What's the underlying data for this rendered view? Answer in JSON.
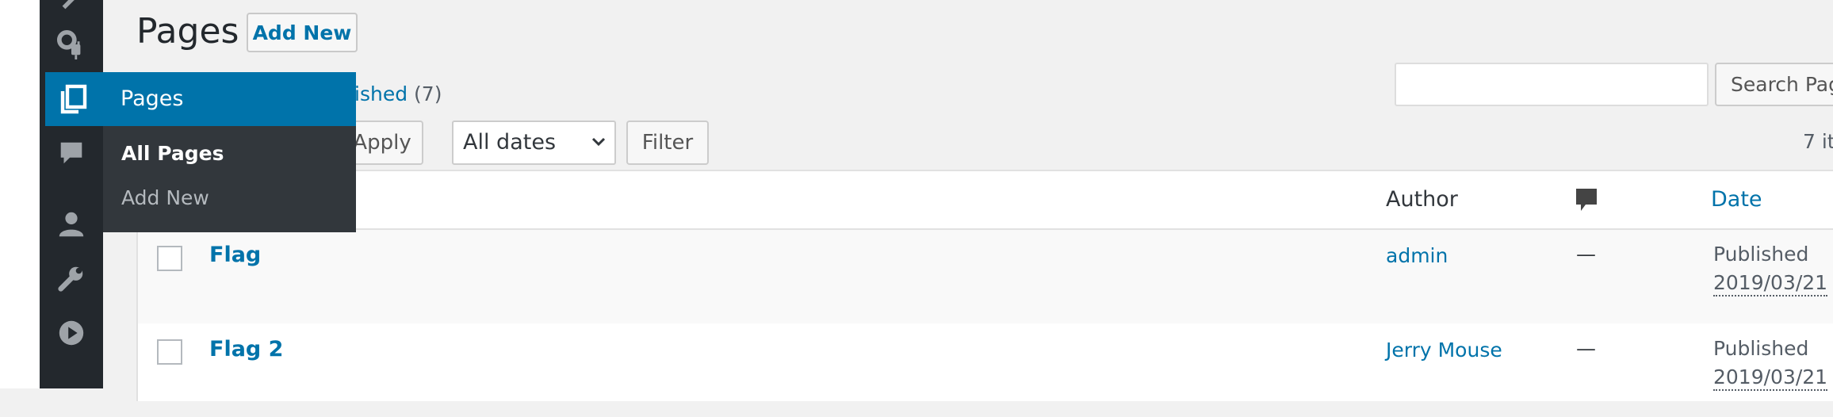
{
  "page": {
    "title": "Pages",
    "add_new": "Add New"
  },
  "menu": {
    "flyout": {
      "header": "Pages",
      "items": [
        "All Pages",
        "Add New"
      ]
    },
    "icons": [
      "appearance-plugins-icon",
      "pages-icon",
      "comments-icon",
      "users-icon",
      "tools-icon",
      "media-play-icon"
    ]
  },
  "filters": {
    "published_label": "ished",
    "published_count": "(7)",
    "apply": "Apply",
    "dates_selected": "All dates",
    "filter": "Filter",
    "search_button": "Search Pag",
    "items_count": "7 it"
  },
  "table": {
    "columns": {
      "author": "Author",
      "date": "Date"
    },
    "rows": [
      {
        "title": "Flag",
        "author": "admin",
        "comments": "—",
        "status": "Published",
        "date": "2019/03/21"
      },
      {
        "title": "Flag 2",
        "author": "Jerry Mouse",
        "comments": "—",
        "status": "Published",
        "date": "2019/03/21"
      }
    ]
  },
  "colors": {
    "accent": "#0073aa",
    "sidebar": "#23282d",
    "submenu": "#32373c"
  }
}
